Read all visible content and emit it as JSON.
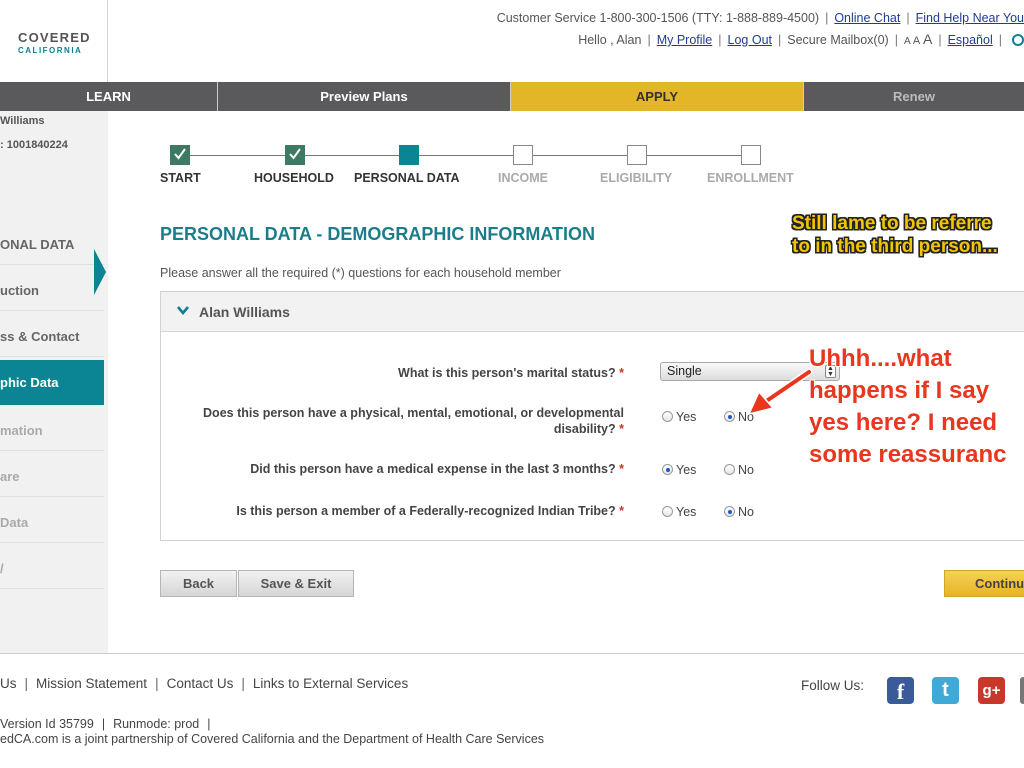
{
  "header": {
    "logo_word1": "COVERED",
    "logo_word2": "CALIFORNIA",
    "customer_service": "Customer Service 1-800-300-1506 (TTY: 1-888-889-4500)",
    "online_chat": "Online Chat",
    "find_help": "Find Help Near You",
    "greeting": "Hello , Alan",
    "my_profile": "My Profile",
    "log_out": "Log Out",
    "secure_mailbox": "Secure Mailbox(0)",
    "text_size": [
      "A",
      "A",
      "A"
    ],
    "espanol": "Español"
  },
  "nav": {
    "tabs": [
      {
        "label": "LEARN"
      },
      {
        "label": "Preview Plans"
      },
      {
        "label": "APPLY",
        "active": true
      },
      {
        "label": "Renew"
      }
    ],
    "active_color": "#e2b627",
    "bar_color": "#5a5a5c"
  },
  "sidebar": {
    "name": "Williams",
    "case_id": ": 1001840224",
    "items": [
      {
        "label": "ONAL DATA"
      },
      {
        "label": "uction"
      },
      {
        "label": "ss & Contact"
      },
      {
        "label": "phic Data",
        "active": true
      },
      {
        "label": "mation"
      },
      {
        "label": "are"
      },
      {
        "label": " Data"
      },
      {
        "label": "/"
      }
    ],
    "active_color": "#0b8593"
  },
  "progress": {
    "steps": [
      {
        "label": "START",
        "state": "done"
      },
      {
        "label": "HOUSEHOLD",
        "state": "done"
      },
      {
        "label": "PERSONAL DATA",
        "state": "current"
      },
      {
        "label": "INCOME",
        "state": "todo"
      },
      {
        "label": "ELIGIBILITY",
        "state": "todo"
      },
      {
        "label": "ENROLLMENT",
        "state": "todo"
      }
    ]
  },
  "main": {
    "title": "PERSONAL DATA - DEMOGRAPHIC INFORMATION",
    "instructions": "Please answer all the required (*) questions for each household member",
    "member_name": "Alan Williams",
    "required_mark": "*",
    "questions": [
      {
        "text": "What is this person's marital status?",
        "type": "select",
        "value": "Single"
      },
      {
        "text": "Does this person have a physical, mental, emotional, or developmental disability?",
        "type": "radio",
        "yes": "Yes",
        "no": "No",
        "selected": "No"
      },
      {
        "text": "Did this person have a medical expense in the last 3 months?",
        "type": "radio",
        "yes": "Yes",
        "no": "No",
        "selected": "Yes"
      },
      {
        "text": "Is this person a member of a Federally-recognized Indian Tribe?",
        "type": "radio",
        "yes": "Yes",
        "no": "No",
        "selected": "No"
      }
    ],
    "title_color": "#1c7d8a"
  },
  "buttons": {
    "back": "Back",
    "save_exit": "Save & Exit",
    "continue": "Continu"
  },
  "annotations": {
    "note1": [
      "Still lame to be referre",
      "to in the third person..."
    ],
    "note2": [
      "Uhhh....what",
      "happens if I say",
      "yes here? I need",
      "some reassuranc"
    ]
  },
  "footer": {
    "links": [
      "Us",
      "Mission Statement",
      "Contact Us",
      "Links to External Services"
    ],
    "follow_us": "Follow Us:",
    "social_icons": [
      "facebook-icon",
      "twitter-icon",
      "google-plus-icon"
    ],
    "version": "Version Id 35799",
    "runmode": "Runmode: prod",
    "partnership": "edCA.com is a joint partnership of Covered California and the Department of Health Care Services"
  }
}
